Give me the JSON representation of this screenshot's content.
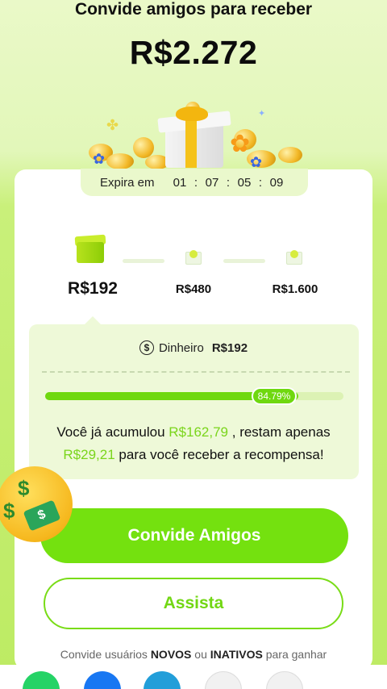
{
  "header": {
    "title": "Convide amigos para receber",
    "amount": "R$2.272"
  },
  "expiry": {
    "label": "Expira em",
    "days": "01",
    "hours": "07",
    "minutes": "05",
    "seconds": "09",
    "separator": ":"
  },
  "tiers": [
    {
      "amount": "R$192",
      "active": true
    },
    {
      "amount": "R$480",
      "active": false
    },
    {
      "amount": "R$1.600",
      "active": false
    }
  ],
  "panel": {
    "cash_label": "Dinheiro",
    "cash_amount": "R$192",
    "progress_percent": 84.79,
    "progress_label": "84.79%",
    "message_prefix": "Você já acumulou",
    "accumulated": "R$162,79",
    "message_middle": ", restam apenas",
    "remaining": "R$29,21",
    "message_suffix": "para você receber a recompensa!"
  },
  "buttons": {
    "invite_label": "Convide Amigos",
    "watch_label": "Assista"
  },
  "footer": {
    "note_prefix": "Convide usuários",
    "new_word": "NOVOS",
    "or_word": "ou",
    "inactive_word": "INATIVOS",
    "note_suffix": "para ganhar"
  },
  "emoji": {
    "eye_symbol": "$",
    "money_symbol": "$"
  },
  "share_icons": [
    "whatsapp-icon",
    "facebook-icon",
    "telegram-icon",
    "help-icon",
    "more-icon"
  ],
  "colors": {
    "accent": "#74e10f",
    "accent_text": "#7ad51b",
    "whatsapp": "#25d366",
    "facebook": "#1877f2",
    "telegram": "#229ed9"
  }
}
